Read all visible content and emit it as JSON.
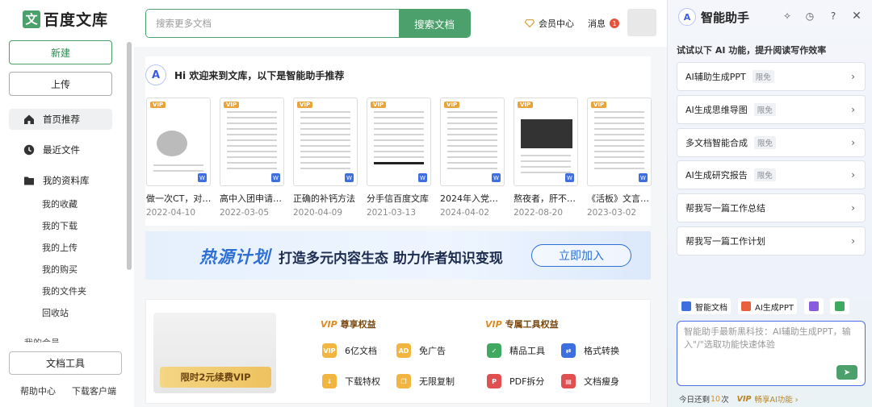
{
  "logo": {
    "mark": "文",
    "text": "百度文库"
  },
  "sidebar": {
    "new_label": "新建",
    "upload_label": "上传",
    "nav": [
      {
        "label": "首页推荐",
        "icon": "home-icon",
        "active": true
      },
      {
        "label": "最近文件",
        "icon": "clock-icon",
        "active": false
      },
      {
        "label": "我的资料库",
        "icon": "folder-icon",
        "active": false
      }
    ],
    "subnav": [
      "我的收藏",
      "我的下载",
      "我的上传",
      "我的购买",
      "我的文件夹",
      "回收站"
    ],
    "partial_item": "我的会员",
    "doc_tools_label": "文档工具",
    "footer": [
      "帮助中心",
      "下载客户端"
    ]
  },
  "header": {
    "search_placeholder": "搜索更多文档",
    "search_button": "搜索文档",
    "vip_label": "会员中心",
    "msg_label": "消息",
    "msg_count": "1"
  },
  "recommend": {
    "ai_mark": "A",
    "title": "Hi 欢迎来到文库，以下是智能助手推荐",
    "docs": [
      {
        "title": "做一次CT，对…",
        "date": "2022-04-10",
        "vip": true
      },
      {
        "title": "高中入团申请…",
        "date": "2022-03-05",
        "vip": true
      },
      {
        "title": "正确的补钙方法",
        "date": "2020-04-09",
        "vip": true
      },
      {
        "title": "分手信百度文库",
        "date": "2021-03-13",
        "vip": true
      },
      {
        "title": "2024年入党…",
        "date": "2024-04-02",
        "vip": true
      },
      {
        "title": "熬夜者，肝不…",
        "date": "2022-08-20",
        "vip": true
      },
      {
        "title": "《活板》文言…",
        "date": "2023-03-02",
        "vip": true
      }
    ],
    "vip_tag": "VIP",
    "word_tag": "W"
  },
  "banner": {
    "title": "热源计划",
    "subtitle": "打造多元内容生态 助力作者知识变现",
    "button": "立即加入"
  },
  "vip": {
    "renew_button": "限时2元续费VIP",
    "section1": {
      "badge": "VIP",
      "title": "尊享权益"
    },
    "section2": {
      "badge": "VIP",
      "title": "专属工具权益"
    },
    "perks1": [
      "6亿文档",
      "免广告",
      "下载特权",
      "无限复制"
    ],
    "perks2": [
      "精品工具",
      "格式转换",
      "PDF拆分",
      "文档瘦身"
    ]
  },
  "assistant": {
    "ai_mark": "A",
    "title": "智能助手",
    "hint": "试试以下 AI 功能，提升阅读写作效率",
    "items": [
      {
        "label": "AI辅助生成PPT",
        "tag": "限免"
      },
      {
        "label": "AI生成思维导图",
        "tag": "限免"
      },
      {
        "label": "多文档智能合成",
        "tag": "限免"
      },
      {
        "label": "AI生成研究报告",
        "tag": "限免"
      },
      {
        "label": "帮我写一篇工作总结",
        "tag": ""
      },
      {
        "label": "帮我写一篇工作计划",
        "tag": ""
      }
    ],
    "chips": [
      "智能文档",
      "AI生成PPT"
    ],
    "input_placeholder": "智能助手最新黑科技：AI辅助生成PPT，输入\"/\"选取功能快速体验",
    "footer_prefix": "今日还剩",
    "footer_count": "10",
    "footer_suffix": "次",
    "footer_vip": "VIP",
    "footer_link": "畅享AI功能 ›"
  },
  "colors": {
    "brand_green": "#4ca06b",
    "accent_blue": "#2e6fd6",
    "vip_gold": "#e8a33b",
    "badge_red": "#e5533d"
  }
}
